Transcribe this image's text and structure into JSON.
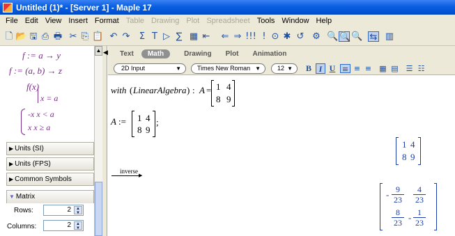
{
  "window": {
    "title": "Untitled (1)* - [Server 1] - Maple 17"
  },
  "menu": {
    "items": [
      {
        "label": "File",
        "enabled": true
      },
      {
        "label": "Edit",
        "enabled": true
      },
      {
        "label": "View",
        "enabled": true
      },
      {
        "label": "Insert",
        "enabled": true
      },
      {
        "label": "Format",
        "enabled": true
      },
      {
        "label": "Table",
        "enabled": false
      },
      {
        "label": "Drawing",
        "enabled": false
      },
      {
        "label": "Plot",
        "enabled": false
      },
      {
        "label": "Spreadsheet",
        "enabled": false
      },
      {
        "label": "Tools",
        "enabled": true
      },
      {
        "label": "Window",
        "enabled": true
      },
      {
        "label": "Help",
        "enabled": true
      }
    ]
  },
  "toolbar": {
    "icons": [
      "new-document-icon",
      "open-folder-icon",
      "save-icon",
      "print-icon",
      "print-preview-icon",
      "cut-icon",
      "copy-icon",
      "paste-icon",
      "undo-icon",
      "redo-icon",
      "math-icon",
      "text-icon",
      "prompt-icon",
      "sum-icon",
      "insert-table-icon",
      "outdent-icon",
      "back-icon",
      "forward-icon",
      "execute-all-icon",
      "execute-icon",
      "debug-icon",
      "stop-icon",
      "restart-icon",
      "zoom-100-icon",
      "zoom-150-icon",
      "zoom-200-icon",
      "sheet-icon",
      "assistant-icon"
    ],
    "glyphs": [
      "🗋",
      "📂",
      "🖫",
      "⎙",
      "🖶",
      "✂",
      "⎘",
      "📋",
      "↶",
      "↷",
      "Σ",
      "T",
      "▷",
      "∑",
      "▦",
      "⇤",
      "⇐",
      "⇒",
      "!!!",
      "!",
      "⊙",
      "✱",
      "↺",
      "⚙",
      "🔍",
      "🔍",
      "🔍",
      "⇆",
      "▥"
    ]
  },
  "context_bar": {
    "tabs": [
      "Text",
      "Math",
      "Drawing",
      "Plot",
      "Animation"
    ],
    "active_tab": "Math",
    "input_mode": "2D Input",
    "font": "Times New Roman",
    "font_size": "12",
    "bold": "B",
    "italic": "I",
    "underline": "U"
  },
  "palette": {
    "expressions": [
      "f := a → y",
      "f := (a, b) → z",
      "f(x)",
      "x = a",
      "-x  x < a",
      "x  x ≥ a"
    ],
    "sections": [
      {
        "label": "Units (SI)",
        "expanded": false
      },
      {
        "label": "Units (FPS)",
        "expanded": false
      },
      {
        "label": "Common Symbols",
        "expanded": false
      },
      {
        "label": "Matrix",
        "expanded": true
      }
    ],
    "matrix": {
      "rows_label": "Rows:",
      "rows_value": "2",
      "columns_label": "Columns:",
      "columns_value": "2"
    }
  },
  "document": {
    "input1": {
      "cmd": "with",
      "arg": "LinearAlgebra",
      "sep": ":",
      "var": "A",
      "eq": "=",
      "matrix": [
        [
          "1",
          "4"
        ],
        [
          "8",
          "9"
        ]
      ]
    },
    "input2": {
      "var": "A",
      "assign": ":=",
      "matrix": [
        [
          "1",
          "4"
        ],
        [
          "8",
          "9"
        ]
      ],
      "end": ";"
    },
    "output1": {
      "matrix": [
        [
          "1",
          "4"
        ],
        [
          "8",
          "9"
        ]
      ]
    },
    "context_label": "inverse",
    "output2": {
      "matrix": [
        [
          "-",
          "9",
          "23",
          "",
          "4",
          "23"
        ],
        [
          "",
          "8",
          "23",
          "-",
          "1",
          "23"
        ]
      ]
    }
  },
  "colors": {
    "titlebar": "#0a5fe0",
    "palette_expr": "#7a2d88",
    "output": "#1b3da8",
    "chrome": "#ece9d8"
  }
}
